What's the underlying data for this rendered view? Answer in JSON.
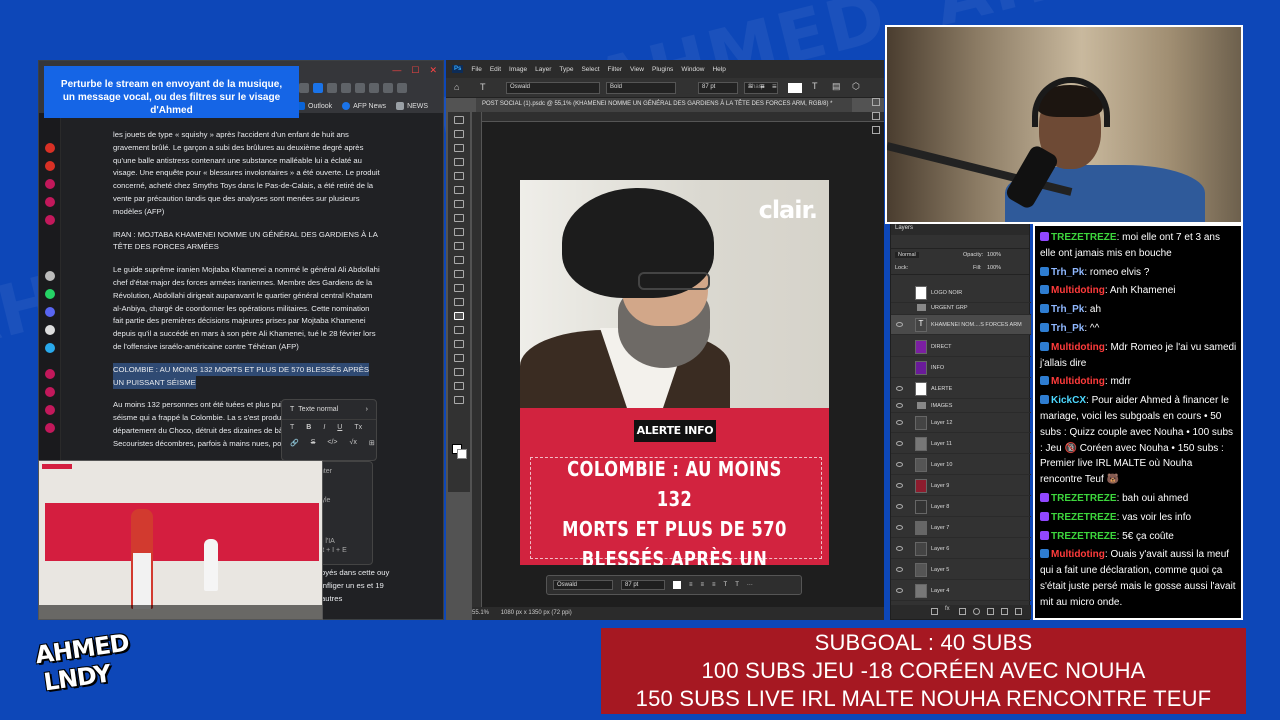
{
  "stream": {
    "alert_banner_line1": "Perturbe le stream en envoyant de la musique,",
    "alert_banner_line2": "un message vocal, ou des filtres sur le visage d'Ahmed",
    "logo_line1": "AHMED",
    "logo_line2": "LNDY"
  },
  "browser": {
    "bookmarks": [
      {
        "label": "Outlook",
        "icon": "outlook-icon",
        "color": "#0a64d8"
      },
      {
        "label": "AFP News",
        "icon": "afp-icon",
        "color": "#1a73e8"
      },
      {
        "label": "NEWS",
        "icon": "folder-icon",
        "color": "#9aa0a6"
      }
    ],
    "article": {
      "para1": "les jouets de type « squishy » après l'accident d'un enfant de huit ans gravement brûlé. Le garçon a subi des brûlures au deuxième degré après qu'une balle antistress contenant une substance malléable lui a éclaté au visage. Une enquête pour « blessures involontaires » a été ouverte. Le produit concerné, acheté chez Smyths Toys dans le Pas-de-Calais, a été retiré de la vente par précaution tandis que des analyses sont menées sur plusieurs modèles (AFP)",
      "heading2": "IRAN : MOJTABA KHAMENEI NOMME UN GÉNÉRAL DES GARDIENS À LA TÊTE DES FORCES ARMÉES",
      "para2": "Le guide suprême iranien Mojtaba Khamenei a nommé le général Ali Abdollahi chef d'état-major des forces armées iraniennes. Membre des Gardiens de la Révolution, Abdollahi dirigeait auparavant le quartier général central Khatam al-Anbiya, chargé de coordonner les opérations militaires. Cette nomination fait partie des premières décisions majeures prises par Mojtaba Khamenei depuis qu'il a succédé en mars à son père Ali Khamenei, tué le 28 février lors de l'offensive israélo-américaine contre Téhéran (AFP)",
      "heading3": "COLOMBIE : AU MOINS 132 MORTS ET PLUS DE 570 BLESSÉS APRÈS UN PUISSANT SÉISME",
      "para3": "Au moins 132 personnes ont été tuées et plus puissant séisme qui a frappé la Colombie. La s s'est produite dans le département du Choco, détruit des dizaines de bâtiments. Secouristes décombres, parfois à mains nues, pour retrou",
      "para3_tail": "oyés dans cette ouy infliger un es et 19 autres"
    },
    "format_popup": {
      "label": "Texte normal",
      "buttons_row1": [
        "T",
        "B",
        "I",
        "U",
        "Tx"
      ],
      "buttons_row2": [
        "🔗",
        "S",
        "</>",
        "√x",
        "⊞"
      ]
    },
    "side_menu": {
      "item1": "enter",
      "item2": "style",
      "item3": "ec l'IA",
      "item4": "Alt + I + E"
    }
  },
  "photoshop": {
    "menu": [
      "File",
      "Edit",
      "Image",
      "Layer",
      "Type",
      "Select",
      "Filter",
      "View",
      "Plugins",
      "Window",
      "Help"
    ],
    "font": "Oswald",
    "style": "Bold",
    "size": "87 pt",
    "aa": "Sharp",
    "doc_tab": "POST SOCIAL (1).psdc @ 55,1% (KHAMENEI NOMME UN GÉNÉRAL DES GARDIENS À LA TÊTE DES FORCES ARM, RGB/8) *",
    "zoom": "55.1%",
    "doc_size": "1080 px x 1350 px (72 ppi)",
    "poster": {
      "brand": "clair.",
      "label": "ALERTE INFO",
      "headline_line1": "COLOMBIE : AU MOINS 132",
      "headline_line2": "MORTS ET PLUS DE 570",
      "headline_line3": "BLESSÉS APRÈS UN"
    },
    "context_bar": {
      "font": "Oswald",
      "size": "87 pt"
    },
    "layers_panel": {
      "title": "Layers",
      "blend": "Normal",
      "opacity_label": "Opacity:",
      "opacity": "100%",
      "fill_label": "Fill:",
      "fill": "100%",
      "lock_label": "Lock:",
      "layers": [
        "LOGO NOIR",
        "URGENT GRP",
        "KHAMENEI NOM....S FORCES ARM",
        "DIRECT",
        "INFO",
        "ALERTE",
        "IMAGES",
        "Layer 12",
        "Layer 11",
        "Layer 10",
        "Layer 9",
        "Layer 8",
        "Layer 7",
        "Layer 6",
        "Layer 5",
        "Layer 4"
      ]
    }
  },
  "chat": [
    {
      "user": "TREZETREZE",
      "color": "green",
      "text": "moi elle ont 7 et 3 ans elle ont jamais mis en bouche"
    },
    {
      "user": "Trh_Pk",
      "color": "blue",
      "text": "romeo elvis ?"
    },
    {
      "user": "Multidoting",
      "color": "red",
      "text": "Anh Khamenei"
    },
    {
      "user": "Trh_Pk",
      "color": "blue",
      "text": "ah"
    },
    {
      "user": "Trh_Pk",
      "color": "blue",
      "text": "^^"
    },
    {
      "user": "Multidoting",
      "color": "red",
      "text": "Mdr Romeo je l'ai vu samedi j'allais dire"
    },
    {
      "user": "Multidoting",
      "color": "red",
      "text": "mdrr"
    },
    {
      "user": "KickCX",
      "color": "cyan",
      "text": "Pour aider Ahmed à financer le mariage, voici les subgoals en cours • 50 subs : Quizz couple avec Nouha • 100 subs : Jeu 🔞 Coréen avec Nouha • 150 subs : Premier live IRL MALTE où Nouha rencontre Teuf 🐻"
    },
    {
      "user": "TREZETREZE",
      "color": "green",
      "text": "bah oui ahmed"
    },
    {
      "user": "TREZETREZE",
      "color": "green",
      "text": "vas voir les info"
    },
    {
      "user": "TREZETREZE",
      "color": "green",
      "text": "5€ ça coûte"
    },
    {
      "user": "Multidoting",
      "color": "red",
      "text": "Ouais y'avait aussi la meuf qui a fait une déclaration, comme quoi ça s'était juste persé mais le gosse aussi l'avait mit au micro onde."
    }
  ],
  "subgoal": {
    "line1": "SUBGOAL : 40 SUBS",
    "line2": "100 SUBS JEU -18 CORÉEN AVEC NOUHA",
    "line3": "150 SUBS LIVE IRL MALTE NOUHA RENCONTRE TEUF"
  }
}
